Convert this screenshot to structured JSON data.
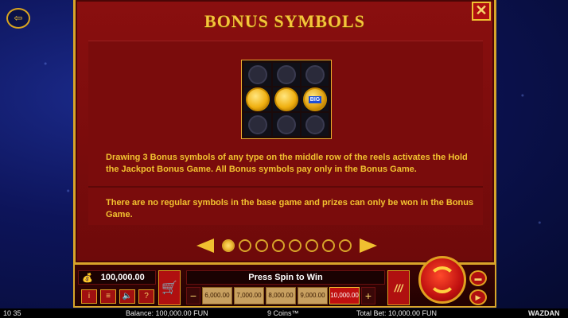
{
  "panel": {
    "title": "BONUS SYMBOLS",
    "close": "✕",
    "desc1": "Drawing 3 Bonus symbols of any type on the middle row of the reels activates the Hold the Jackpot Bonus Game. All Bonus symbols pay only in the Bonus Game.",
    "desc2": "There are no regular symbols in the base game and prizes can only be won in the Bonus Game.",
    "page_count": 8,
    "active_page": 1,
    "reel_blue_coin_label": "BIG"
  },
  "controls": {
    "balance_value": "100,000.00",
    "message": "Press Spin to Win",
    "bets": [
      "6,000.00",
      "7,000.00",
      "8,000.00",
      "9,000.00",
      "10,000.00"
    ],
    "selected_bet": "10,000.00",
    "minus": "−",
    "plus": "+"
  },
  "status": {
    "time": "10 35",
    "balance": "Balance: 100,000.00 FUN",
    "coins": "9 Coins™",
    "total_bet": "Total Bet: 10,000.00 FUN",
    "brand": "WAZDAN"
  },
  "colors": {
    "gold": "#f2c230",
    "panel_red": "#8a0f0f",
    "selected_bet": "#c01010"
  }
}
